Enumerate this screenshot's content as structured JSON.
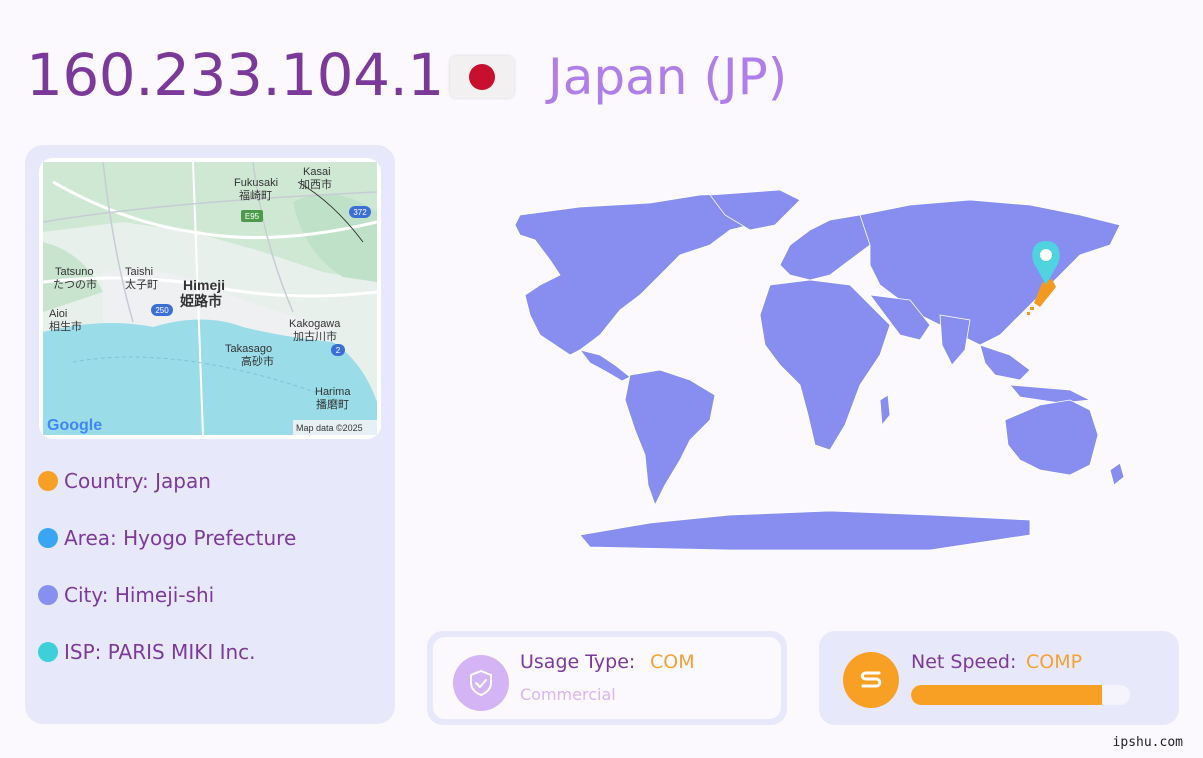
{
  "header": {
    "ip": "160.233.104.1",
    "country_title": "Japan (JP)",
    "flag_icon": "japan-flag-icon"
  },
  "map": {
    "attribution": "Map data ©2025",
    "logo": "Google",
    "labels": {
      "kasai": "Kasai",
      "kasai_jp": "加西市",
      "fukusaki": "Fukusaki",
      "fukusaki_jp": "福崎町",
      "route_e95": "E95",
      "route_372": "372",
      "tatsuno": "Tatsuno",
      "tatsuno_jp": "たつの市",
      "taishi": "Taishi",
      "taishi_jp": "太子町",
      "himeji": "Himeji",
      "himeji_jp": "姫路市",
      "aioi": "Aioi",
      "aioi_jp": "相生市",
      "route_250": "250",
      "kakogawa": "Kakogawa",
      "kakogawa_jp": "加古川市",
      "takasago": "Takasago",
      "takasago_jp": "高砂市",
      "route_2": "2",
      "harima": "Harima",
      "harima_jp": "播磨町"
    }
  },
  "info": {
    "country": "Country: Japan",
    "area": "Area: Hyogo Prefecture",
    "city": "City: Himeji-shi",
    "isp": "ISP: PARIS MIKI Inc."
  },
  "usage": {
    "label": "Usage Type:",
    "value": "COM",
    "sub": "Commercial",
    "icon": "shield-check-icon"
  },
  "speed": {
    "label": "Net Speed:",
    "value": "COMP",
    "icon": "speed-s-icon",
    "level": 0.87
  },
  "colors": {
    "ip": "#7b3a9a",
    "country_title": "#b07ee8",
    "bullet_country": "#f8a024",
    "bullet_area": "#3aa6f3",
    "bullet_city": "#8790f0",
    "bullet_isp": "#3dd0da",
    "world_land": "#878ef0",
    "pin": "#4fd3de",
    "japan": "#f29a1f"
  },
  "footer": {
    "watermark": "ipshu.com"
  }
}
